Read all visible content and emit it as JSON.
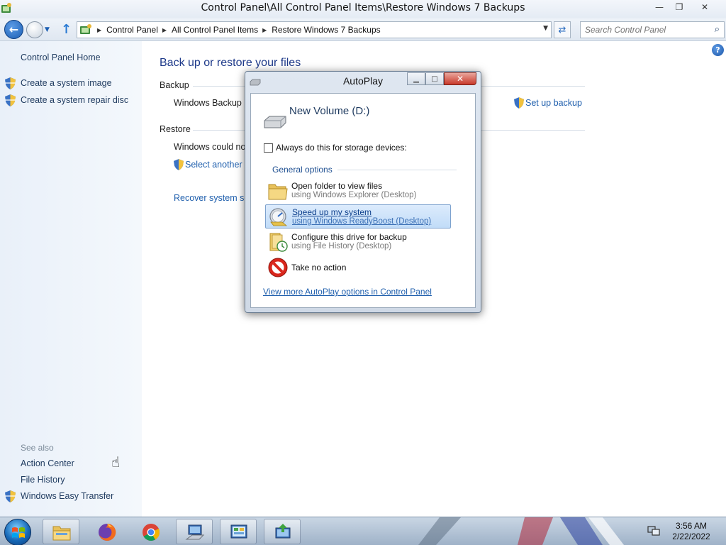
{
  "window": {
    "title": "Control Panel\\All Control Panel Items\\Restore Windows 7 Backups",
    "buttons": {
      "minimize": "—",
      "restore": "❐",
      "close": "✕"
    }
  },
  "address": {
    "crumbs": [
      "Control Panel",
      "All Control Panel Items",
      "Restore Windows 7 Backups"
    ],
    "search_placeholder": "Search Control Panel"
  },
  "leftnav": {
    "home": "Control Panel Home",
    "tasks": [
      "Create a system image",
      "Create a system repair disc"
    ],
    "see_also_label": "See also",
    "see_also": [
      "Action Center",
      "File History",
      "Windows Easy Transfer"
    ]
  },
  "main": {
    "heading": "Back up or restore your files",
    "backup_label": "Backup",
    "backup_text": "Windows Backup h",
    "setup_link": "Set up backup",
    "restore_label": "Restore",
    "restore_text": "Windows could no",
    "select_link": "Select another b",
    "recover_link": "Recover system set"
  },
  "dialog": {
    "title": "AutoPlay",
    "drive_name": "New Volume (D:)",
    "checkbox_label": "Always do this for storage devices:",
    "checkbox_checked": false,
    "group_label": "General options",
    "options": [
      {
        "title": "Open folder to view files",
        "subtitle": "using Windows Explorer (Desktop)",
        "icon": "folder-icon"
      },
      {
        "title": "Speed up my system",
        "subtitle": "using Windows ReadyBoost (Desktop)",
        "icon": "readyboost-icon",
        "selected": true
      },
      {
        "title": "Configure this drive for backup",
        "subtitle": "using File History (Desktop)",
        "icon": "file-history-icon"
      },
      {
        "title": "Take no action",
        "subtitle": "",
        "icon": "no-action-icon"
      }
    ],
    "footer_link": "View more AutoPlay options in Control Panel"
  },
  "taskbar": {
    "apps": [
      "file-explorer-icon",
      "firefox-icon",
      "chrome-icon",
      "network-computer-icon",
      "control-panel-icon",
      "windows-easy-transfer-icon"
    ],
    "clock_time": "3:56 AM",
    "clock_date": "2/22/2022"
  },
  "colors": {
    "link": "#1f5fad",
    "heading": "#1e3a8a",
    "selection": "#c1dcf8"
  }
}
